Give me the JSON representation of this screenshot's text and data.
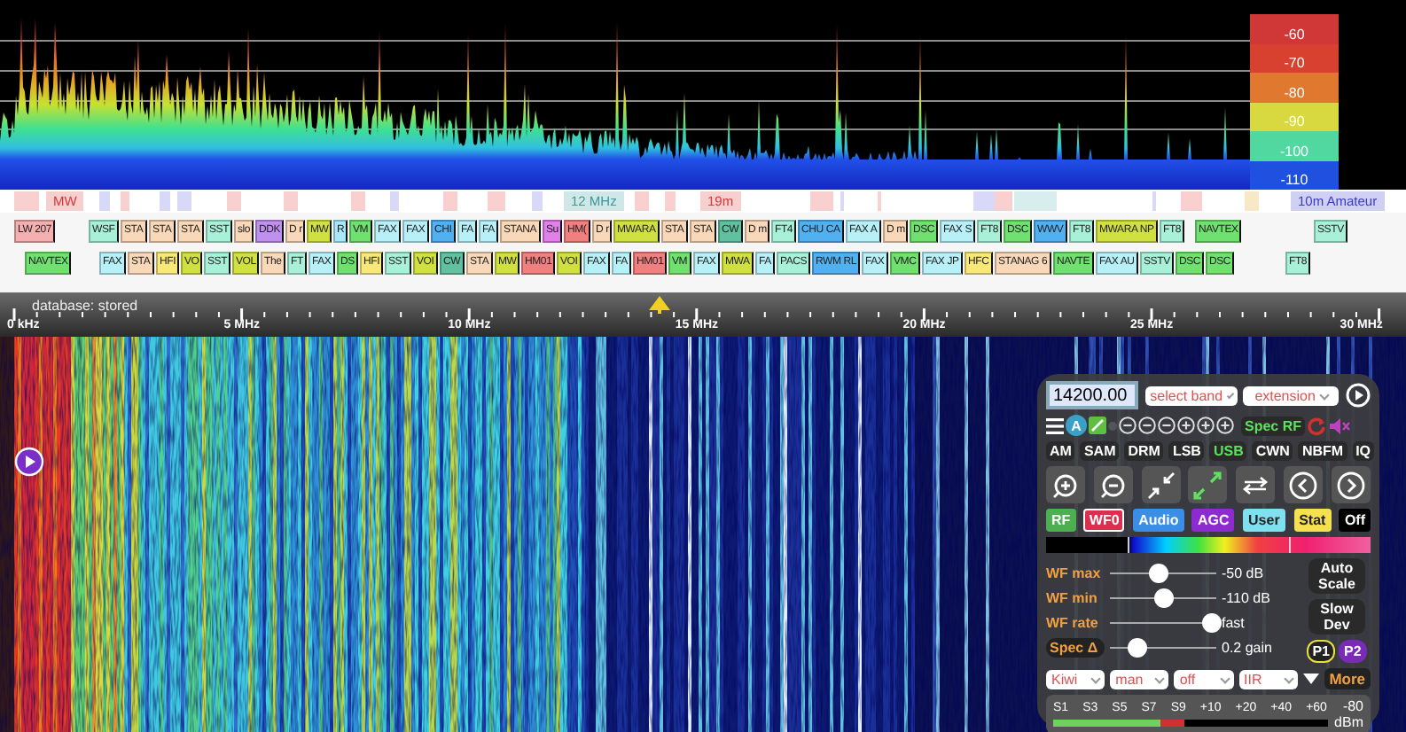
{
  "spectrum": {
    "db_scale": [
      "-60",
      "-70",
      "-80",
      "-90",
      "-100",
      "-110"
    ]
  },
  "band_bar": {
    "labels": [
      {
        "text": "MW",
        "color": "#d83838"
      },
      {
        "text": "12 MHz",
        "color": "#3a9a9a"
      },
      {
        "text": "19m",
        "color": "#d83838"
      },
      {
        "text": "10m Amateur",
        "color": "#3a3ac8"
      }
    ]
  },
  "station_rows": [
    [
      {
        "text": "LW 207",
        "color": "#f4b0b0"
      },
      {
        "text": "WSF",
        "color": "#a8f0d8"
      },
      {
        "text": "STA",
        "color": "#f8d8b8"
      },
      {
        "text": "STA",
        "color": "#f8d8b8"
      },
      {
        "text": "STA",
        "color": "#f8d8b8"
      },
      {
        "text": "SST",
        "color": "#a8f0d8"
      },
      {
        "text": "slo",
        "color": "#f8d8b8"
      },
      {
        "text": "DDK",
        "color": "#c090f0"
      },
      {
        "text": "D r",
        "color": "#f8d8b8"
      },
      {
        "text": "MW",
        "color": "#d0e040"
      },
      {
        "text": "R",
        "color": "#a8e8f8"
      },
      {
        "text": "VM",
        "color": "#70e070"
      },
      {
        "text": "FAX",
        "color": "#b8f0f8"
      },
      {
        "text": "FAX",
        "color": "#b8f0f8"
      },
      {
        "text": "CHI",
        "color": "#50b0f0"
      },
      {
        "text": "FA",
        "color": "#b8f0f8"
      },
      {
        "text": "FA",
        "color": "#b8f0f8"
      },
      {
        "text": "STANA",
        "color": "#f8d8b8"
      },
      {
        "text": "Su",
        "color": "#e080e8"
      },
      {
        "text": "HM(",
        "color": "#f08080"
      },
      {
        "text": "D r",
        "color": "#f8d8b8"
      },
      {
        "text": "MWARA",
        "color": "#d0e040"
      },
      {
        "text": "STA",
        "color": "#f8d8b8"
      },
      {
        "text": "STA",
        "color": "#f8d8b8"
      },
      {
        "text": "CW",
        "color": "#60c0a0"
      },
      {
        "text": "D m",
        "color": "#f8d8b8"
      },
      {
        "text": "FT4",
        "color": "#a8f0d8"
      },
      {
        "text": "CHU CA",
        "color": "#50b0f0"
      },
      {
        "text": "FAX A",
        "color": "#b8f0f8"
      },
      {
        "text": "D m",
        "color": "#f8d8b8"
      },
      {
        "text": "DSC",
        "color": "#70e070"
      },
      {
        "text": "FAX S",
        "color": "#b8f0f8"
      },
      {
        "text": "FT8",
        "color": "#a8f0d8"
      },
      {
        "text": "DSC",
        "color": "#70e070"
      },
      {
        "text": "WWV",
        "color": "#50b0f0"
      },
      {
        "text": "FT8",
        "color": "#a8f0d8"
      },
      {
        "text": "MWARA NP",
        "color": "#d0e040"
      },
      {
        "text": "FT8",
        "color": "#a8f0d8"
      },
      {
        "text": "NAVTEX",
        "color": "#70e070"
      },
      {
        "text": "SSTV",
        "color": "#a8f0d8"
      }
    ],
    [
      {
        "text": "NAVTEX",
        "color": "#70e070"
      },
      {
        "text": "FAX",
        "color": "#b8f0f8"
      },
      {
        "text": "STA",
        "color": "#f8d8b8"
      },
      {
        "text": "HFI",
        "color": "#f8e878"
      },
      {
        "text": "VO",
        "color": "#d0e040"
      },
      {
        "text": "SST",
        "color": "#a8f0d8"
      },
      {
        "text": "VOL",
        "color": "#d0e040"
      },
      {
        "text": "The",
        "color": "#f8d8b8"
      },
      {
        "text": "FT",
        "color": "#a8f0d8"
      },
      {
        "text": "FAX",
        "color": "#b8f0f8"
      },
      {
        "text": "DS",
        "color": "#70e070"
      },
      {
        "text": "HFI",
        "color": "#f8e878"
      },
      {
        "text": "SST",
        "color": "#a8f0d8"
      },
      {
        "text": "VOI",
        "color": "#d0e040"
      },
      {
        "text": "CW",
        "color": "#60c0a0"
      },
      {
        "text": "STA",
        "color": "#f8d8b8"
      },
      {
        "text": "MW",
        "color": "#d0e040"
      },
      {
        "text": "HM01",
        "color": "#f08080"
      },
      {
        "text": "VOI",
        "color": "#d0e040"
      },
      {
        "text": "FAX",
        "color": "#b8f0f8"
      },
      {
        "text": "FA",
        "color": "#b8f0f8"
      },
      {
        "text": "HM01",
        "color": "#f08080"
      },
      {
        "text": "VM",
        "color": "#70e070"
      },
      {
        "text": "FAX",
        "color": "#b8f0f8"
      },
      {
        "text": "MWA",
        "color": "#d0e040"
      },
      {
        "text": "FA",
        "color": "#b8f0f8"
      },
      {
        "text": "PACS",
        "color": "#a8f0d8"
      },
      {
        "text": "RWM RL",
        "color": "#50b0f0"
      },
      {
        "text": "FAX",
        "color": "#b8f0f8"
      },
      {
        "text": "VMC",
        "color": "#70e070"
      },
      {
        "text": "FAX JP",
        "color": "#b8f0f8"
      },
      {
        "text": "HFC",
        "color": "#f8e878"
      },
      {
        "text": "STANAG 6",
        "color": "#f8d8b8"
      },
      {
        "text": "NAVTE",
        "color": "#70e070"
      },
      {
        "text": "FAX AU",
        "color": "#b8f0f8"
      },
      {
        "text": "SSTV",
        "color": "#a8f0d8"
      },
      {
        "text": "DSC",
        "color": "#70e070"
      },
      {
        "text": "DSC",
        "color": "#70e070"
      },
      {
        "text": "FT8",
        "color": "#a8f0d8"
      }
    ]
  ],
  "frequency_scale": {
    "status": "database: stored",
    "labels": [
      "0 kHz",
      "5 MHz",
      "10 MHz",
      "15 MHz",
      "20 MHz",
      "25 MHz",
      "30 MHz"
    ]
  },
  "control_panel": {
    "frequency": {
      "value": "14200.00"
    },
    "band_select": {
      "value": "select band"
    },
    "extension_select": {
      "value": "extension"
    },
    "a_button": "A",
    "spec_button": "Spec RF",
    "modes": [
      {
        "label": "AM",
        "selected": false
      },
      {
        "label": "SAM",
        "selected": false
      },
      {
        "label": "DRM",
        "selected": false
      },
      {
        "label": "LSB",
        "selected": false
      },
      {
        "label": "USB",
        "selected": true
      },
      {
        "label": "CWN",
        "selected": false
      },
      {
        "label": "NBFM",
        "selected": false
      },
      {
        "label": "IQ",
        "selected": false
      }
    ],
    "tabs": [
      {
        "label": "RF",
        "color": "#4caf50",
        "selected": false
      },
      {
        "label": "WF0",
        "color": "#d9304f",
        "selected": true
      },
      {
        "label": "Audio",
        "color": "#3a8ee6",
        "selected": false
      },
      {
        "label": "AGC",
        "color": "#8e2bd0",
        "selected": false
      },
      {
        "label": "User",
        "color": "#7fe0f0",
        "selected": false
      },
      {
        "label": "Stat",
        "color": "#f5e050",
        "selected": false
      },
      {
        "label": "Off",
        "color": "#000000",
        "selected": false
      }
    ],
    "sliders": [
      {
        "kind": "label",
        "label": "WF max",
        "level": 0.45,
        "reading": "-50 dB"
      },
      {
        "kind": "label",
        "label": "WF min",
        "level": 0.5,
        "reading": "-110 dB"
      },
      {
        "kind": "label",
        "label": "WF rate",
        "level": 0.95,
        "reading": "fast"
      },
      {
        "kind": "button",
        "label": "Spec Δ",
        "level": 0.25,
        "reading": "0.2 gain"
      }
    ],
    "side_buttons": [
      "Auto Scale",
      "Slow Dev"
    ],
    "presets": [
      {
        "label": "P1",
        "selected": true
      },
      {
        "label": "P2",
        "selected": false
      }
    ],
    "selects": [
      "Kiwi",
      "man",
      "off",
      "IIR"
    ],
    "more_button": "More",
    "s_meter": {
      "labels": [
        "S1",
        "S3",
        "S5",
        "S7",
        "S9",
        "+10",
        "+20",
        "+40",
        "+60"
      ],
      "reading": "-80",
      "unit": "dBm",
      "level": 0.48
    }
  }
}
